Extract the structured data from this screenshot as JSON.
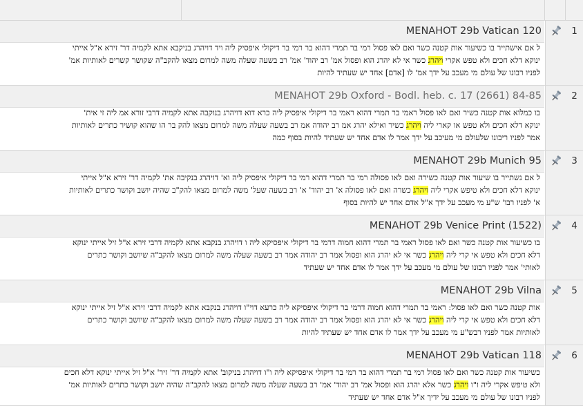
{
  "rows": [
    {
      "num": "1",
      "title": "MENAHOT 29b Vatican 120",
      "lines": [
        [
          "ל אם אישתייר בו כשיעור אות קטנה כשר ואם לאו פסול רמי בר תמרי דהוא בר רמי בר דיקולי איפסיק ליה ויד דויהרג בניקבא אתא לקמיה דר' זירא א\"ל אייתי"
        ],
        [
          "ינוקא דלא חכים ולא טפש אקרי ",
          {
            "hl": "ויהרג"
          },
          " כשר אי לא יהרג הוא ופסול אמ' רב יהוד' אמ' רב בשעה שעלה משה למרום מצאו להקב\"ה שקושר קשרים לאותיות אמ'"
        ],
        [
          "לפניו רבונו של עולם מי מעכב על ידך אמ' לו [אדם] אחד יש שעתיד להיות"
        ]
      ]
    },
    {
      "num": "2",
      "title": "MENAHOT 29b Oxford - Bodl. heb. c. 17 (2661) 84-85",
      "lines": [
        [
          "בו כמלוא אות קטנה כשיר ואם לאו פסול ראמי בר תמרי דהוא ראמי בר דיקולי איפסיק ליה כרא דוא דויהרג בנוקבה אתא לקמיה דרבי זורא אמ ליה זי אית'"
        ],
        [
          "ינוקא דלא חכים ולא טפש או קארי ליה ",
          {
            "hl": "ויהרג"
          },
          " כשיר ואילא יהרג אמ רב יהודה אמ רב בשעה שעלה משה למרום מצאו להק בר הו שהוא קושיר כתרים לאותיות"
        ],
        [
          "אמר לפניו ריבונו שלעולם מי מעיכב על ידך אמר לו אדם אחד יש שעתיד להיות בסוף כמה"
        ]
      ]
    },
    {
      "num": "3",
      "title": "MENAHOT 29b Munich 95",
      "lines": [
        [
          "ל אם נשתייר בו שיעור אות קטנה כשירה ואם לאו פסולה רמי בר תמרי דהוא רמי בר דיקולי איפסיק ליה וא' דויהרג בנקיבה את' לקמיה דר' זירא א\"ל אייתי"
        ],
        [
          "ינוקא דלא חכים ולא טיפש אקרי ליה ",
          {
            "hl": "ויהרג"
          },
          " כשרה ואם לאו פסולה א' רב יהוד' א' רב בשעה שעל' משה למרום מצאו להק\"ב שהיה יושב וקושר כתרים לאותיות"
        ],
        [
          "א' לפניו רבו' ש\"ע מי מעכב על ידך א\"ל אדם אחד יש להיות בסוף"
        ]
      ]
    },
    {
      "num": "4",
      "title": "MENAHOT 29b Venice Print (1522)",
      "lines": [
        [
          "בו כשיעור אות קטנה כשר ואם לאו פסול ראמי בר תמרי דהוא חמוה דרמי בר דיקולי איפסיקא ליה ו דויהרג בנקבא אתא לקמיה דרבי זירא א\"ל זיל אייתי ינוקא"
        ],
        [
          "דלא חכים ולא טפש אי קרי ליה ",
          {
            "hl": "ויהרג"
          },
          " כשר אי לא יהרג הוא ופסול אמר רב יהודה אמר רב בשעה שעלה משה למרום מצאו להקב\"ה שיושב וקושר כתרים"
        ],
        [
          "לאותי' אמר לפניו רבונו של עולם מי מעכב על ידך אמר לו אדם אחד יש שעתיד"
        ]
      ]
    },
    {
      "num": "5",
      "title": "MENAHOT 29b Vilna",
      "lines": [
        [
          "אות קטנה כשר ואם לאו פסול: ראמי בר תמרי דהוא חמוה דרמי בר דיקולי איפסיקא ליה כרעא דוי\"ו דויהרג בנקבא אתא לקמיה דרבי זירא א\"ל זיל אייתי ינוקא"
        ],
        [
          "דלא חכים ולא טפש אי קרי ליה ",
          {
            "hl": "ויהרג"
          },
          " כשר אי לא יהרג הוא ופסול אמר רב יהודה אמר רב בשעה שעלה משה למרום מצאו להקב\"ה שיושב וקושר כתרים"
        ],
        [
          "לאותיות אמר לפניו רבש\"ע מי מעכב על ידך אמר לו אדם אחד יש שעתיד להיות"
        ]
      ]
    },
    {
      "num": "6",
      "title": "MENAHOT 29b Vatican 118",
      "lines": [
        [
          "כשיעור אות קטנה כשר ואם לאו פסול רמי בר תמרי דהוא בר רמי בר דיקולי איפסיקא ליה ו\"ו דויהרג בניקוב' אתא לקמיה דר' זיר' א\"ל זיל אייתי ינוקא דלא חכים"
        ],
        [
          "ולא טיפש אקרי ליה ו\"ו ",
          {
            "hl": "ויהרג"
          },
          " כשר אלא יהרג הוא ופסול אמ' רב יהוד' אמ' רב בשעה שעלה משה למרום מצאו להקב\"ה שהיה יושב וקושר כתרים לאותיות אמ'"
        ],
        [
          "לפניו רבונו של עולם מי מעכב על ידיך א\"ל אדם אחד יש שעתיד"
        ]
      ]
    }
  ]
}
